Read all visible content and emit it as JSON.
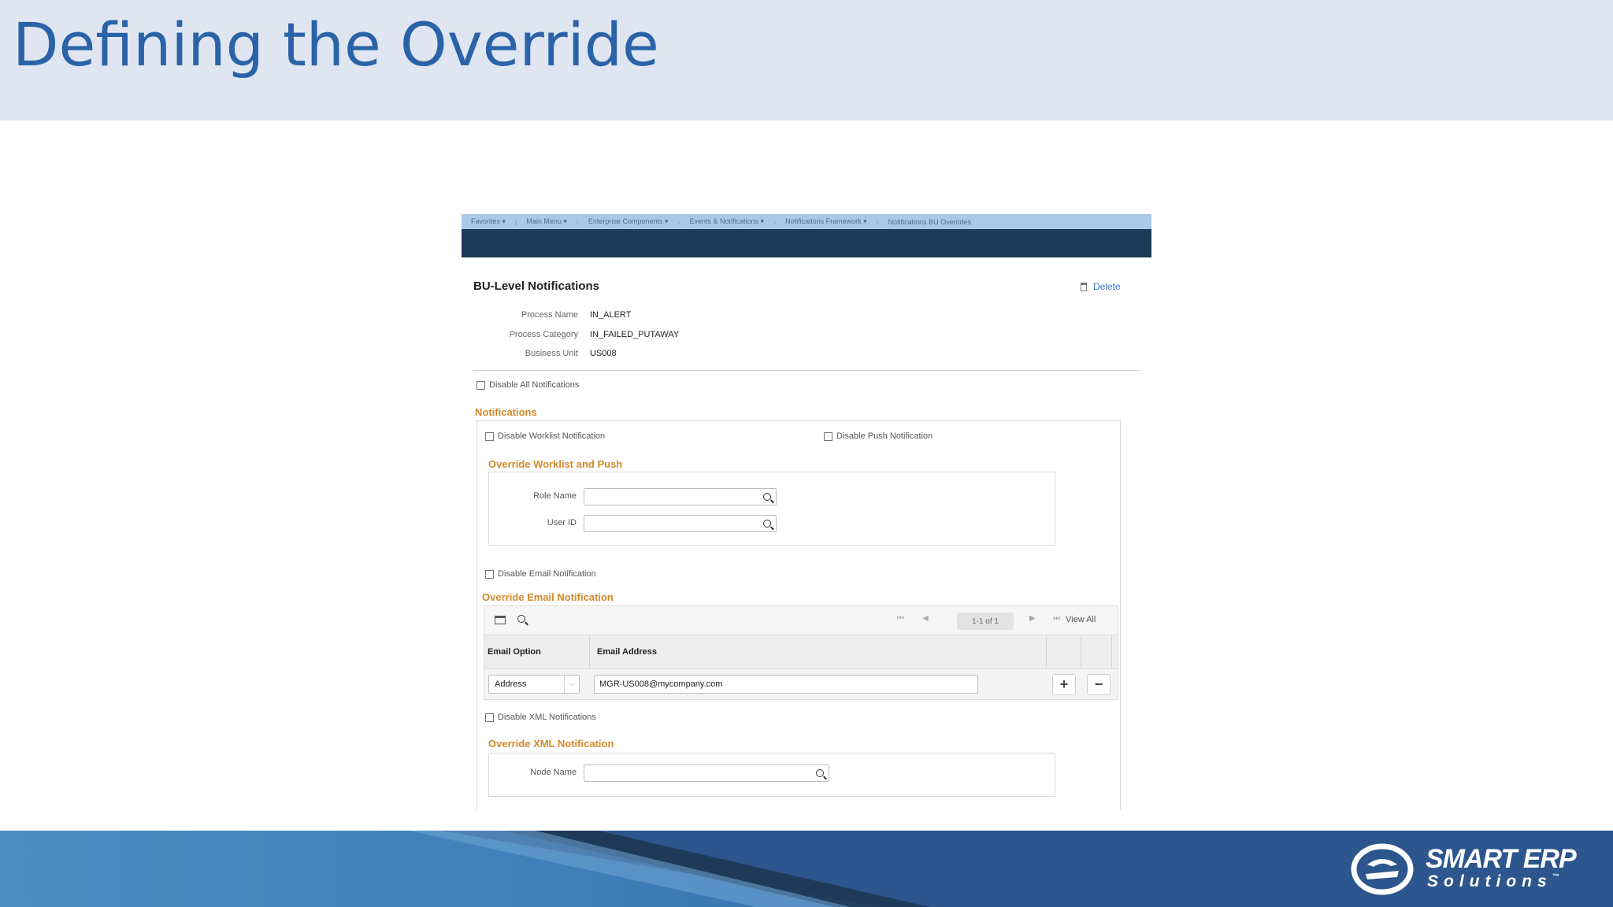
{
  "slide": {
    "title": "Defining the Override"
  },
  "nav": {
    "items": [
      "Favorites ▾",
      "Main Menu ▾",
      "Enterprise Components ▾",
      "Events & Notifications ▾",
      "Notifications Framework ▾",
      "Notifications BU Overrides"
    ]
  },
  "page": {
    "heading": "BU-Level Notifications",
    "delete_label": "Delete",
    "process_name_label": "Process Name",
    "process_name_value": "IN_ALERT",
    "process_category_label": "Process Category",
    "process_category_value": "IN_FAILED_PUTAWAY",
    "business_unit_label": "Business Unit",
    "business_unit_value": "US008",
    "disable_all_label": "Disable All Notifications"
  },
  "notifications": {
    "section_label": "Notifications",
    "disable_worklist_label": "Disable Worklist Notification",
    "disable_push_label": "Disable Push Notification",
    "override_worklist_title": "Override Worklist and Push",
    "role_name_label": "Role Name",
    "user_id_label": "User ID",
    "disable_email_label": "Disable Email Notification",
    "override_email_title": "Override Email Notification",
    "pager_text": "1-1 of 1",
    "view_all_label": "View All",
    "col_email_option": "Email Option",
    "col_email_address": "Email Address",
    "row_email_option": "Address",
    "row_email_address": "MGR-US008@mycompany.com",
    "add_label": "+",
    "remove_label": "−",
    "disable_xml_label": "Disable XML Notifications",
    "override_xml_title": "Override XML Notification",
    "node_name_label": "Node Name"
  },
  "brand": {
    "line1": "SMART ERP",
    "line2": "Solutions",
    "tm": "™"
  },
  "colors": {
    "title_blue": "#2b63a8",
    "section_orange": "#d08a2a",
    "nav_dark": "#1d3a58",
    "footer_blue": "#3e7cb6"
  }
}
